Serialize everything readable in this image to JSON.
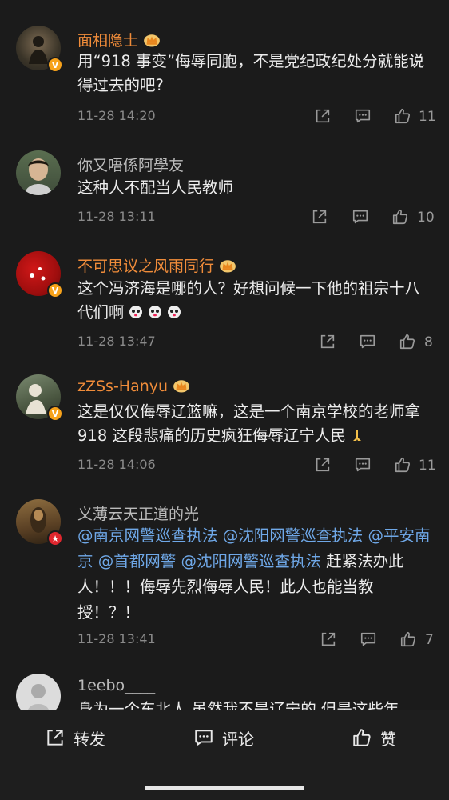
{
  "comments": [
    {
      "username": "面相隐士",
      "text": "用“918 事变”侮辱同胞，不是党纪政纪处分就能说得过去的吧?",
      "time": "11-28 14:20",
      "likes": "11"
    },
    {
      "username": "你又唔係阿學友",
      "text": "这种人不配当人民教师",
      "time": "11-28 13:11",
      "likes": "10"
    },
    {
      "username": "不可思议之风雨同行",
      "text": "这个冯济海是哪的人？好想问候一下他的祖宗十八代们啊",
      "time": "11-28 13:47",
      "likes": "8"
    },
    {
      "username": "zZSs-Hanyu",
      "text": "这是仅仅侮辱辽篮嘛，这是一个南京学校的老师拿 918 这段悲痛的历史疯狂侮辱辽宁人民",
      "time": "11-28 14:06",
      "likes": "11"
    },
    {
      "username": "义薄云天正道的光",
      "mentions": [
        "@南京网警巡查执法",
        "@沈阳网警巡查执法",
        "@平安南京",
        "@首都网警",
        "@沈阳网警巡查执法"
      ],
      "text_after": "赶紧法办此人！！！侮辱先烈侮辱人民！此人也能当教授！？！",
      "time": "11-28 13:41",
      "likes": "7"
    },
    {
      "username": "1eebo____",
      "text": "身为一个东北人 虽然我不是辽宁的 但是这些年"
    }
  ],
  "bottom_bar": {
    "repost": "转发",
    "comment": "评论",
    "like": "赞"
  },
  "colors": {
    "background": "#1b1b1b",
    "vip_name": "#f08c3a",
    "mention": "#6fa8e8",
    "badge_orange": "#f7a21b",
    "badge_red": "#e0262e"
  },
  "icons": [
    "share-icon",
    "comment-icon",
    "thumbs-up-icon",
    "crown-icon",
    "verified-badge-icon"
  ]
}
